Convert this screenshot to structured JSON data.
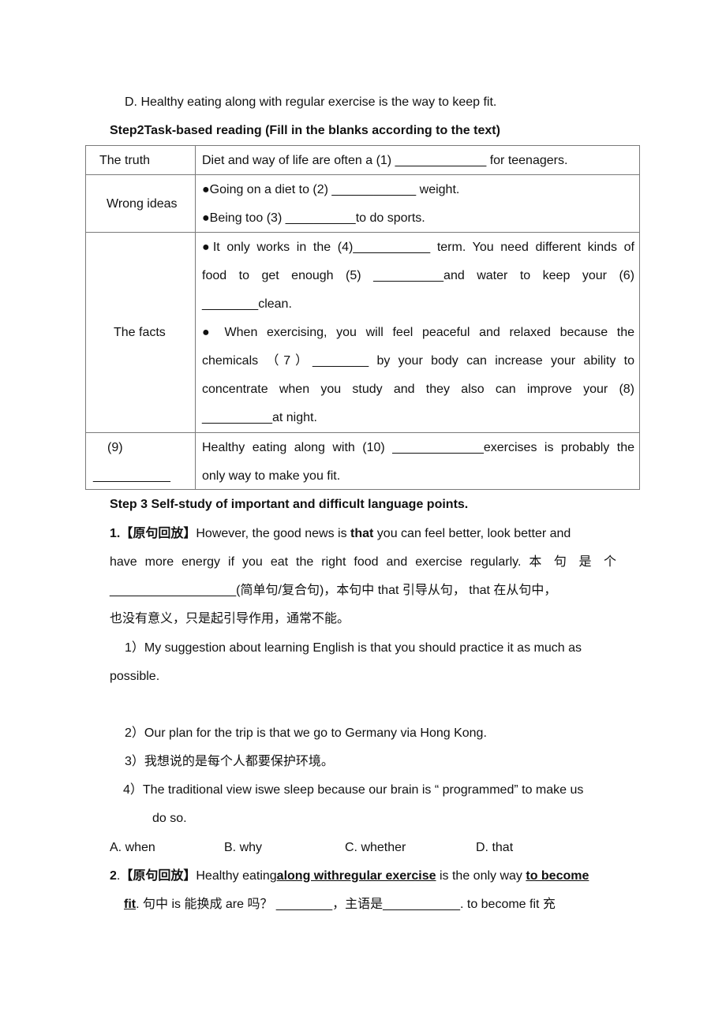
{
  "intro_option": "D. Healthy eating along with regular exercise is the way to keep fit.",
  "step2": {
    "heading": "Step2Task-based reading (Fill in the blanks according to the text)",
    "table": {
      "rows": [
        {
          "label": "The truth",
          "lines": [
            "Diet and way of life are often a (1) _____________ for teenagers."
          ]
        },
        {
          "label": "Wrong ideas",
          "lines": [
            "●Going on a diet to (2) ____________ weight.",
            "●Being too (3) __________to do sports."
          ]
        },
        {
          "label": "The facts",
          "lines": [
            "●It only works in the (4)___________ term. You need different kinds of",
            "food to get enough (5) __________and water to keep your (6)",
            "________clean.",
            "● When exercising, you will feel peaceful and relaxed because the",
            "chemicals （7）________ by your body can increase your ability to",
            "concentrate when you study and they also can improve your (8)",
            "__________at night."
          ]
        },
        {
          "label_lines": [
            "(9)",
            "___________"
          ],
          "lines": [
            "Healthy eating along with (10) _____________exercises is probably the",
            "only way to make you fit."
          ]
        }
      ]
    }
  },
  "step3": {
    "heading": "Step 3 Self-study of important and difficult language points.",
    "point1": {
      "number": "1.",
      "tag": "【原句回放】",
      "line1_pre": "However, the good news is ",
      "line1_bold": "that",
      "line1_post": " you can feel better, look better and",
      "line2": "have more energy if you eat the right food and exercise regularly. 本 句 是 个",
      "line3": "__________________(简单句/复合句)，本句中  that 引导从句，  that 在从句中，",
      "line4": "也没有意义，只是起引导作用，通常不能。",
      "examples": [
        "1）My suggestion about learning English is that you should practice it as much as",
        "possible.",
        "2）Our plan for the trip is that we go to Germany via Hong Kong.",
        "3）我想说的是每个人都要保护环境。",
        "4）The traditional view iswe sleep because our brain is “ programmed” to make us",
        "do so."
      ],
      "options": [
        "A. when",
        "B. why",
        "C. whether",
        "D. that"
      ]
    },
    "point2": {
      "number": "2",
      "dot": ".",
      "tag": "【原句回放】",
      "seg1": "Healthy eating",
      "seg2_bold_u": "along withregular exercise",
      "seg3": " is the only way ",
      "seg4_bold_u": "to become",
      "line2_bold_u": "fit",
      "line2_rest": ". 句中 is  能换成  are  吗？ ________，主语是___________. to become fit  充"
    }
  }
}
